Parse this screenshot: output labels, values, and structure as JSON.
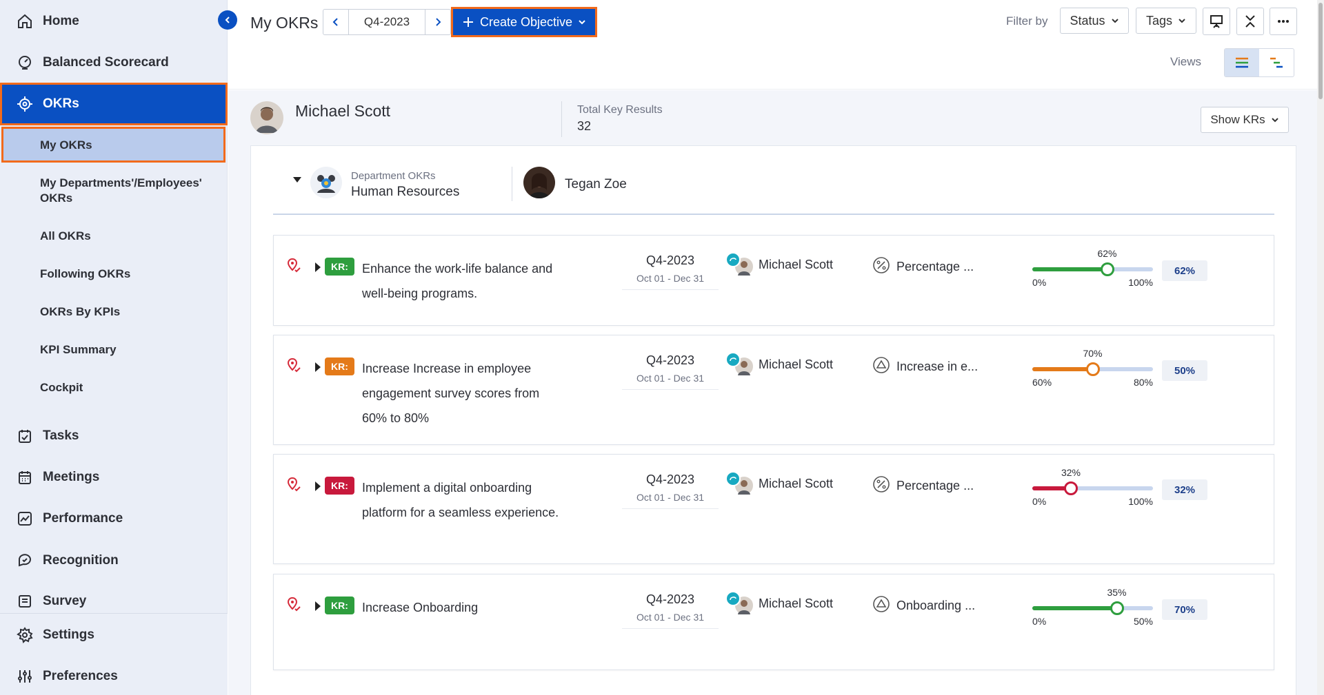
{
  "sidebar": {
    "home": "Home",
    "balanced_scorecard": "Balanced Scorecard",
    "okrs": "OKRs",
    "sub_items": [
      "My OKRs",
      "My Departments'/Employees' OKRs",
      "All OKRs",
      "Following OKRs",
      "OKRs By KPIs",
      "KPI Summary",
      "Cockpit"
    ],
    "tasks": "Tasks",
    "meetings": "Meetings",
    "performance": "Performance",
    "recognition": "Recognition",
    "survey": "Survey",
    "settings": "Settings",
    "preferences": "Preferences"
  },
  "header": {
    "title": "My OKRs",
    "quarter": "Q4-2023",
    "create_label": "Create Objective",
    "filter_by": "Filter by",
    "status": "Status",
    "tags": "Tags",
    "views": "Views"
  },
  "owner": {
    "name": "Michael Scott",
    "total_kr_label": "Total Key Results",
    "total_kr_value": "32",
    "show_krs": "Show KRs"
  },
  "department": {
    "label": "Department OKRs",
    "name": "Human Resources",
    "employee": "Tegan Zoe"
  },
  "colors": {
    "primary": "#0a50c2",
    "highlight": "#f26a1b",
    "green": "#2e9e3e",
    "orange": "#e47a19",
    "red": "#c8193c"
  },
  "key_results": [
    {
      "badge": "KR:",
      "status": "green",
      "title": "Enhance the work-life balance and well-being programs.",
      "quarter": "Q4-2023",
      "range": "Oct 01 - Dec 31",
      "owner": "Michael Scott",
      "metric_icon": "percent-icon",
      "metric": "Percentage ...",
      "progress": 62,
      "progress_label": "62%",
      "min": "0%",
      "max": "100%",
      "score": "62%"
    },
    {
      "badge": "KR:",
      "status": "orange",
      "title": "Increase Increase in employee engagement survey scores from 60% to 80%",
      "quarter": "Q4-2023",
      "range": "Oct 01 - Dec 31",
      "owner": "Michael Scott",
      "metric_icon": "increase-icon",
      "metric": "Increase in e...",
      "progress": 50,
      "progress_label": "70%",
      "min": "60%",
      "max": "80%",
      "score": "50%"
    },
    {
      "badge": "KR:",
      "status": "red",
      "title": "Implement a digital onboarding platform for a seamless experience.",
      "quarter": "Q4-2023",
      "range": "Oct 01 - Dec 31",
      "owner": "Michael Scott",
      "metric_icon": "percent-icon",
      "metric": "Percentage ...",
      "progress": 32,
      "progress_label": "32%",
      "min": "0%",
      "max": "100%",
      "score": "32%"
    },
    {
      "badge": "KR:",
      "status": "green",
      "title": "Increase Onboarding",
      "quarter": "Q4-2023",
      "range": "Oct 01 - Dec 31",
      "owner": "Michael Scott",
      "metric_icon": "increase-icon",
      "metric": "Onboarding ...",
      "progress": 70,
      "progress_label": "35%",
      "min": "0%",
      "max": "50%",
      "score": "70%"
    }
  ]
}
